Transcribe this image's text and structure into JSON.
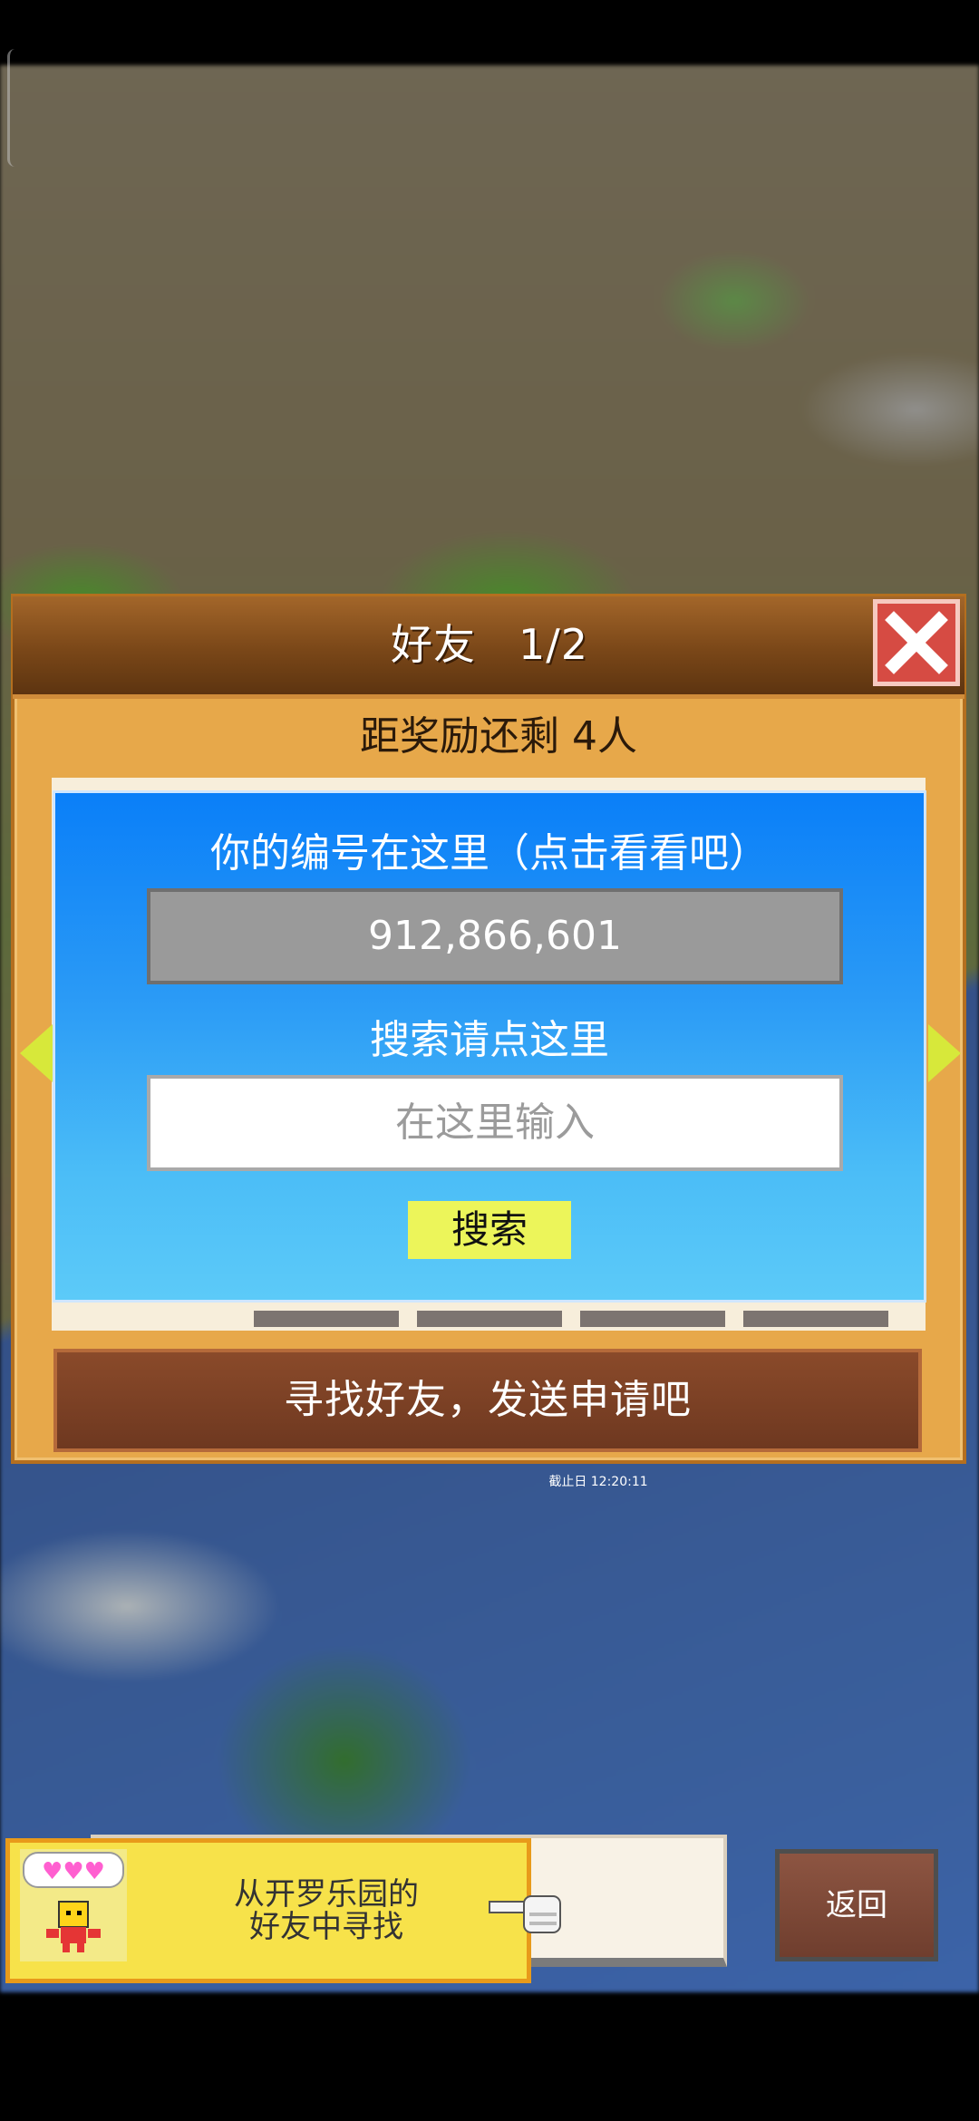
{
  "dialog": {
    "title": "好友　1/2",
    "reward_text": "距奖励还剩 4人",
    "id_label": "你的编号在这里（点击看看吧）",
    "player_id": "912,866,601",
    "search_label": "搜索请点这里",
    "search_placeholder": "在这里输入",
    "search_button": "搜索",
    "find_button": "寻找好友，发送申请吧",
    "deadline": "截止日 12:20:11"
  },
  "bottom": {
    "hint_text_line1": "从开罗乐园的",
    "hint_text_line2": "好友中寻找",
    "back_button": "返回"
  },
  "colors": {
    "accent_blue": "#0a7ff8",
    "close_red": "#d64b43",
    "search_yellow": "#ecf55a",
    "dialog_orange": "#e7a84a"
  },
  "icons": [
    "close-icon",
    "arrow-left-icon",
    "arrow-right-icon",
    "hearts-icon",
    "robot-avatar-icon",
    "pointing-hand-icon"
  ]
}
